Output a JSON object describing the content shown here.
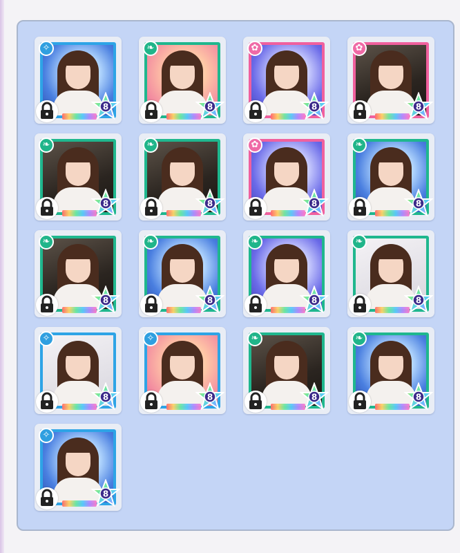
{
  "colors": {
    "panel": "#c4d5f6",
    "frame_blue": "#2ea4e6",
    "frame_pink": "#f0609e",
    "frame_green": "#1fb78e"
  },
  "cards": [
    {
      "frame": "blue",
      "bg": "blue",
      "attr": "blue",
      "attr_icon": "diamond-sparkle-icon",
      "locked": true,
      "level": "8"
    },
    {
      "frame": "green",
      "bg": "peach",
      "attr": "green",
      "attr_icon": "leaf-icon",
      "locked": true,
      "level": "8"
    },
    {
      "frame": "pink",
      "bg": "violet",
      "attr": "pink",
      "attr_icon": "flower-icon",
      "locked": true,
      "level": "8"
    },
    {
      "frame": "pink",
      "bg": "dark",
      "attr": "pink",
      "attr_icon": "flower-icon",
      "locked": true,
      "level": "8"
    },
    {
      "frame": "green",
      "bg": "dark",
      "attr": "green",
      "attr_icon": "leaf-icon",
      "locked": true,
      "level": "8"
    },
    {
      "frame": "green",
      "bg": "dark",
      "attr": "green",
      "attr_icon": "leaf-icon",
      "locked": true,
      "level": "8"
    },
    {
      "frame": "pink",
      "bg": "violet",
      "attr": "pink",
      "attr_icon": "flower-icon",
      "locked": true,
      "level": "8"
    },
    {
      "frame": "green",
      "bg": "blue",
      "attr": "green",
      "attr_icon": "leaf-icon",
      "locked": true,
      "level": "8"
    },
    {
      "frame": "green",
      "bg": "dark",
      "attr": "green",
      "attr_icon": "leaf-icon",
      "locked": true,
      "level": "8"
    },
    {
      "frame": "green",
      "bg": "blue",
      "attr": "green",
      "attr_icon": "leaf-icon",
      "locked": true,
      "level": "8"
    },
    {
      "frame": "green",
      "bg": "violet",
      "attr": "green",
      "attr_icon": "leaf-icon",
      "locked": true,
      "level": "8"
    },
    {
      "frame": "green",
      "bg": "light",
      "attr": "green",
      "attr_icon": "leaf-icon",
      "locked": true,
      "level": "8"
    },
    {
      "frame": "blue",
      "bg": "light",
      "attr": "blue",
      "attr_icon": "diamond-sparkle-icon",
      "locked": true,
      "level": "8"
    },
    {
      "frame": "blue",
      "bg": "peach",
      "attr": "blue",
      "attr_icon": "diamond-sparkle-icon",
      "locked": true,
      "level": "8"
    },
    {
      "frame": "green",
      "bg": "dark",
      "attr": "green",
      "attr_icon": "leaf-icon",
      "locked": true,
      "level": "8"
    },
    {
      "frame": "green",
      "bg": "blue",
      "attr": "green",
      "attr_icon": "leaf-icon",
      "locked": true,
      "level": "8"
    },
    {
      "frame": "blue",
      "bg": "blue",
      "attr": "blue",
      "attr_icon": "diamond-sparkle-icon",
      "locked": true,
      "level": "8"
    }
  ]
}
